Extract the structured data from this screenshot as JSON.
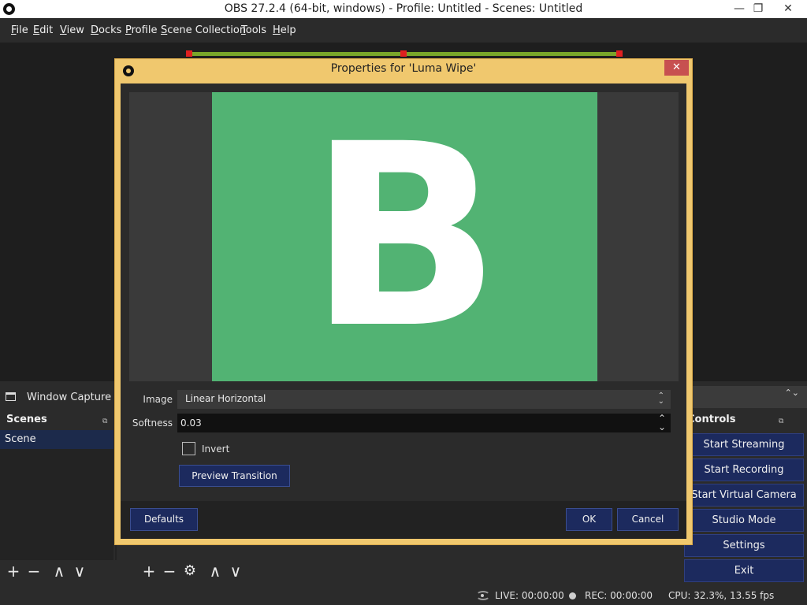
{
  "window": {
    "title": "OBS 27.2.4 (64-bit, windows) - Profile: Untitled - Scenes: Untitled",
    "minimize": "—",
    "restore": "❐",
    "close": "✕"
  },
  "menu": {
    "items": [
      {
        "label": "File",
        "u": "F",
        "rest": "ile"
      },
      {
        "label": "Edit",
        "u": "E",
        "rest": "dit"
      },
      {
        "label": "View",
        "u": "V",
        "rest": "iew"
      },
      {
        "label": "Docks",
        "u": "D",
        "rest": "ocks"
      },
      {
        "label": "Profile",
        "u": "P",
        "rest": "rofile"
      },
      {
        "label": "Scene Collection",
        "u": "S",
        "rest": "cene Collection"
      },
      {
        "label": "Tools",
        "u": "T",
        "rest": "ools"
      },
      {
        "label": "Help",
        "u": "H",
        "rest": "elp"
      }
    ]
  },
  "source_bar": {
    "source_name": "Window Capture",
    "combo_arrow": "⌃⌄"
  },
  "scenes": {
    "title": "Scenes",
    "float_icon": "⧉",
    "items": [
      "Scene"
    ]
  },
  "controls": {
    "title": "Controls",
    "float_icon": "⧉",
    "buttons": [
      "Start Streaming",
      "Start Recording",
      "Start Virtual Camera",
      "Studio Mode",
      "Settings",
      "Exit"
    ]
  },
  "toolbar": {
    "add": "+",
    "remove": "−",
    "up": "∧",
    "down": "∨",
    "gear": "⚙"
  },
  "status": {
    "live": "LIVE: 00:00:00",
    "rec": "REC: 00:00:00",
    "cpu": "CPU: 32.3%, 13.55 fps"
  },
  "dialog": {
    "title": "Properties for 'Luma Wipe'",
    "close": "✕",
    "preview_letter": "B",
    "image_label": "Image",
    "image_value": "Linear Horizontal",
    "softness_label": "Softness",
    "softness_value": "0.03",
    "invert_label": "Invert",
    "invert_checked": false,
    "preview_button": "Preview Transition",
    "defaults_button": "Defaults",
    "ok_button": "OK",
    "cancel_button": "Cancel"
  },
  "colors": {
    "accent_blue": "#1c2a5e",
    "dialog_frame": "#f0c86e",
    "preview_green": "#52b373",
    "selection_red": "#e02020"
  }
}
